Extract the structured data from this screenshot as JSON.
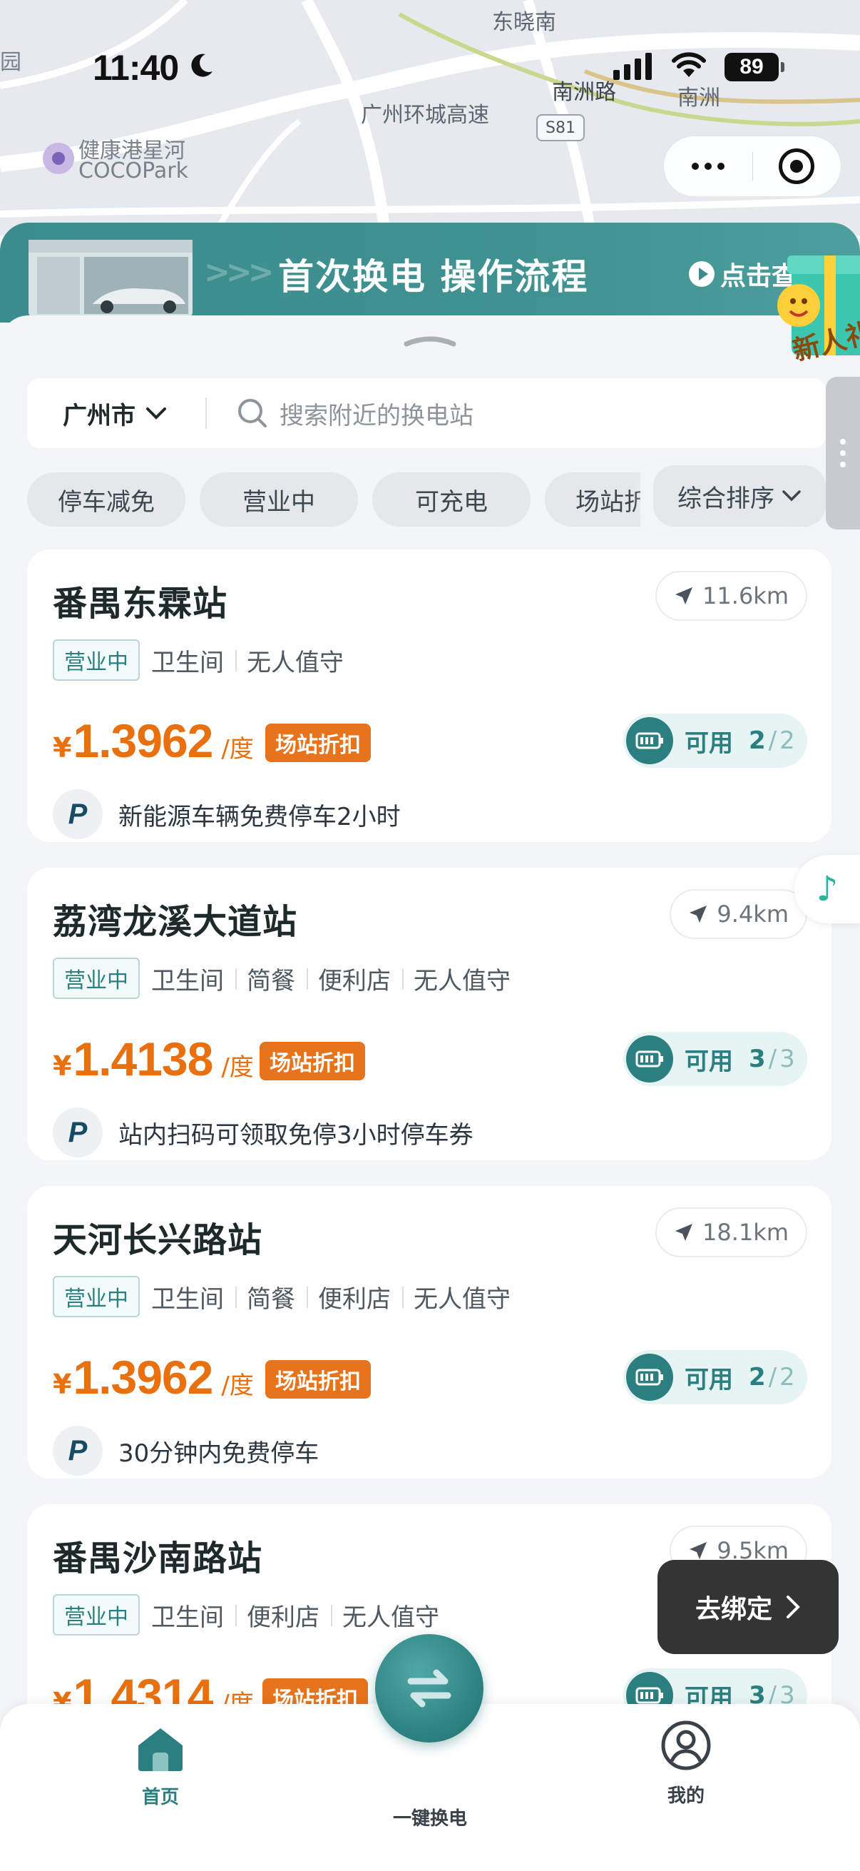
{
  "status_bar": {
    "time": "11:40",
    "battery": "89"
  },
  "map": {
    "labels": [
      "东晓南",
      "南洲路",
      "南洲",
      "广州环城高速",
      "S81",
      "健康港星河",
      "COCOPark",
      "园"
    ]
  },
  "banner": {
    "title": "首次换电 操作流程",
    "link": "点击查",
    "gift_text": "新人礼"
  },
  "search": {
    "city": "广州市",
    "placeholder": "搜索附近的换电站"
  },
  "filters": [
    "停车减免",
    "营业中",
    "可充电",
    "场站折扣"
  ],
  "sort_label": "综合排序",
  "stations": [
    {
      "name": "番禺东霖站",
      "distance": "11.6km",
      "status": "营业中",
      "amenities": [
        "卫生间",
        "无人值守"
      ],
      "yen": "¥",
      "price": "1.3962",
      "unit": "/度",
      "discount": "场站折扣",
      "avail_label": "可用",
      "avail_now": "2",
      "avail_sep": "/",
      "avail_total": "2",
      "perk": "新能源车辆免费停车2小时",
      "perk_icon": "P"
    },
    {
      "name": "荔湾龙溪大道站",
      "distance": "9.4km",
      "status": "营业中",
      "amenities": [
        "卫生间",
        "简餐",
        "便利店",
        "无人值守"
      ],
      "yen": "¥",
      "price": "1.4138",
      "unit": "/度",
      "discount": "场站折扣",
      "avail_label": "可用",
      "avail_now": "3",
      "avail_sep": "/",
      "avail_total": "3",
      "perk": "站内扫码可领取免停3小时停车券",
      "perk_icon": "P"
    },
    {
      "name": "天河长兴路站",
      "distance": "18.1km",
      "status": "营业中",
      "amenities": [
        "卫生间",
        "简餐",
        "便利店",
        "无人值守"
      ],
      "yen": "¥",
      "price": "1.3962",
      "unit": "/度",
      "discount": "场站折扣",
      "avail_label": "可用",
      "avail_now": "2",
      "avail_sep": "/",
      "avail_total": "2",
      "perk": "30分钟内免费停车",
      "perk_icon": "P"
    },
    {
      "name": "番禺沙南路站",
      "distance": "9.5km",
      "status": "营业中",
      "amenities": [
        "卫生间",
        "便利店",
        "无人值守"
      ],
      "yen": "¥",
      "price": "1.4314",
      "unit": "/度",
      "discount": "场站折扣",
      "avail_label": "可用",
      "avail_now": "3",
      "avail_sep": "/",
      "avail_total": "3",
      "perk": "",
      "perk_icon": "P"
    }
  ],
  "bind_tip": "去绑定",
  "tabbar": {
    "home": "首页",
    "swap": "一键换电",
    "me": "我的"
  },
  "colors": {
    "accent": "#2b7f80",
    "price": "#e8700f",
    "discount": "#e7741c"
  },
  "icons": [
    "moon-icon",
    "signal-icon",
    "wifi-icon",
    "battery-icon",
    "more-icon",
    "close-target-icon",
    "play-icon",
    "gift-icon",
    "chevron-down-icon",
    "search-icon",
    "location-arrow-icon",
    "battery-charge-icon",
    "parking-icon",
    "music-note-icon",
    "chevron-right-icon",
    "home-icon",
    "swap-icon",
    "user-icon"
  ]
}
